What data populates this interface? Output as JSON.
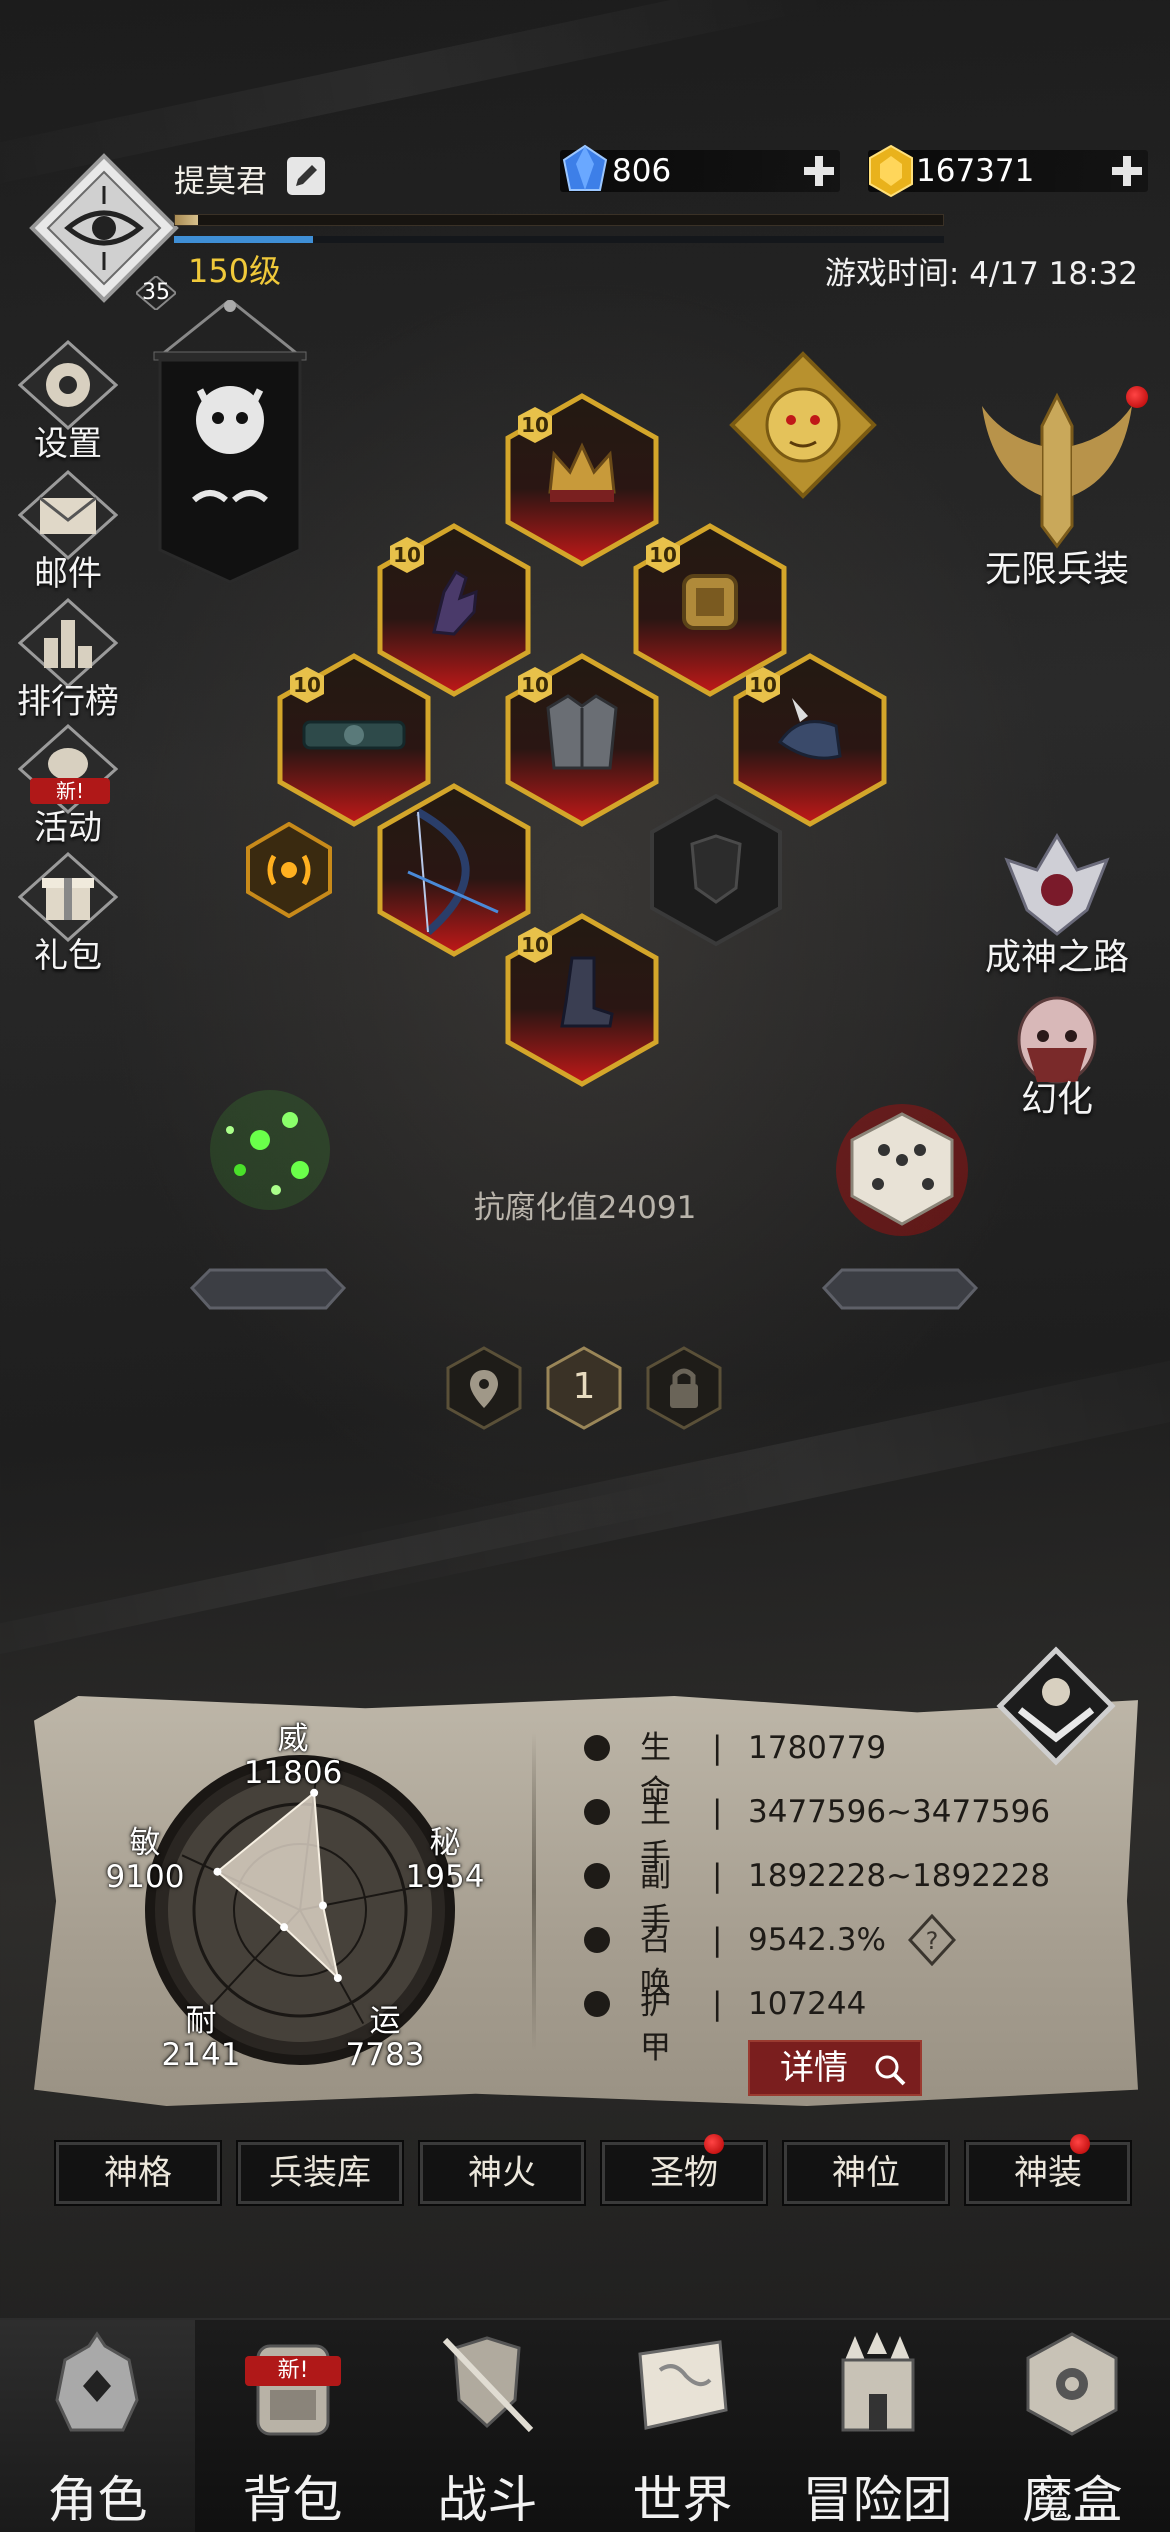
{
  "player": {
    "name": "提莫君",
    "level_text": "150级",
    "badge": "35",
    "xp_progress": 0.03,
    "mp_progress": 0.18
  },
  "currency": {
    "gems": "806",
    "gold": "167371"
  },
  "game_time": "游戏时间: 4/17 18:32",
  "left_menu": [
    {
      "label": "设置",
      "icon": "gear-icon"
    },
    {
      "label": "邮件",
      "icon": "mail-icon"
    },
    {
      "label": "排行榜",
      "icon": "ranking-icon"
    },
    {
      "label": "活动",
      "icon": "event-icon",
      "tag": "新!"
    },
    {
      "label": "礼包",
      "icon": "gift-icon"
    }
  ],
  "equipment": {
    "helmet": {
      "level": "10",
      "icon": "crown-icon"
    },
    "gloves": {
      "level": "10",
      "icon": "gauntlet-icon"
    },
    "ring": {
      "level": "10",
      "icon": "ring-icon"
    },
    "belt": {
      "level": "10",
      "icon": "belt-icon"
    },
    "armor": {
      "level": "10",
      "icon": "armor-icon"
    },
    "shoulder": {
      "level": "10",
      "icon": "pauldron-icon"
    },
    "weapon": {
      "icon": "bow-icon"
    },
    "boots": {
      "level": "10",
      "icon": "boots-icon"
    }
  },
  "right_menu": {
    "infinite_gear": "无限兵装",
    "path_to_god": "成神之路",
    "illusion": "幻化"
  },
  "corrosion": "抗腐化值24091",
  "loadout": {
    "current_slot": "1"
  },
  "radar": {
    "labels": [
      {
        "name": "威",
        "value": "11806"
      },
      {
        "name": "秘",
        "value": "1954"
      },
      {
        "name": "运",
        "value": "7783"
      },
      {
        "name": "耐",
        "value": "2141"
      },
      {
        "name": "敏",
        "value": "9100"
      }
    ],
    "values": [
      11806,
      1954,
      7783,
      2141,
      9100
    ],
    "max": 13000
  },
  "stats": [
    {
      "label": "生命",
      "value": "1780779"
    },
    {
      "label": "主手",
      "value": "3477596~3477596"
    },
    {
      "label": "副手",
      "value": "1892228~1892228"
    },
    {
      "label": "召唤",
      "value": "9542.3%"
    },
    {
      "label": "护甲",
      "value": "107244"
    }
  ],
  "stat_separator": "|",
  "detail_button": "详情",
  "sub_tabs": [
    {
      "label": "神格",
      "dot": false
    },
    {
      "label": "兵装库",
      "dot": false
    },
    {
      "label": "神火",
      "dot": false
    },
    {
      "label": "圣物",
      "dot": true
    },
    {
      "label": "神位",
      "dot": false
    },
    {
      "label": "神装",
      "dot": true
    }
  ],
  "bottom_nav": [
    {
      "label": "角色",
      "icon": "helmet-icon",
      "active": true
    },
    {
      "label": "背包",
      "icon": "backpack-icon",
      "tag": "新!"
    },
    {
      "label": "战斗",
      "icon": "shield-swords-icon"
    },
    {
      "label": "世界",
      "icon": "map-scroll-icon"
    },
    {
      "label": "冒险团",
      "icon": "castle-icon"
    },
    {
      "label": "魔盒",
      "icon": "magic-cube-icon"
    }
  ],
  "colors": {
    "accent_gold": "#f0c93a",
    "accent_red": "#b01818",
    "panel_paper": "#a69e90",
    "mana_blue": "#3f8fd6"
  }
}
